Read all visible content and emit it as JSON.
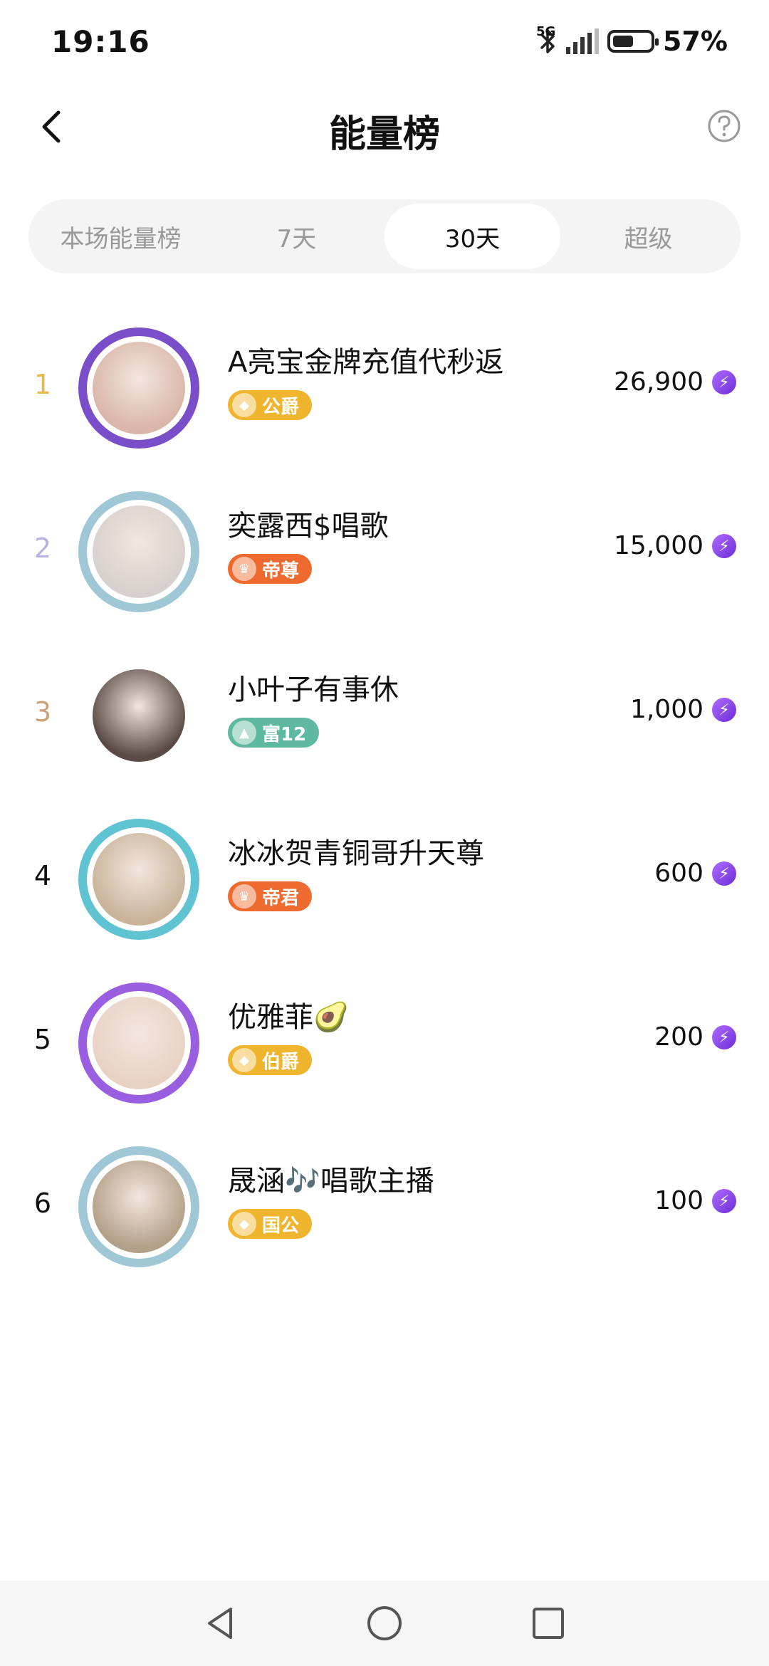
{
  "status": {
    "time": "19:16",
    "network": "5G",
    "battery": "57%",
    "battery_level": 0.57
  },
  "header": {
    "title": "能量榜",
    "back_icon": "chevron-left-icon",
    "help_icon": "question-circle-icon"
  },
  "tabs": [
    {
      "label": "本场能量榜",
      "active": false
    },
    {
      "label": "7天",
      "active": false
    },
    {
      "label": "30天",
      "active": true
    },
    {
      "label": "超级",
      "active": false
    }
  ],
  "ranking": [
    {
      "rank": "1",
      "rank_color": "#e6b84a",
      "name": "A亮宝金牌充值代秒返",
      "badge": "公爵",
      "badge_color": "#f0b52e",
      "frame_color": "#7b4ec9",
      "avatar_color": "#d9b6a8",
      "score": "26,900"
    },
    {
      "rank": "2",
      "rank_color": "#b8b2e0",
      "name": "奕露西$唱歌",
      "badge": "帝尊",
      "badge_color": "#ee6a2e",
      "frame_color": "#9fc7d6",
      "avatar_color": "#d7d0cc",
      "score": "15,000"
    },
    {
      "rank": "3",
      "rank_color": "#c9a27a",
      "name": "小叶子有事休",
      "badge": "富12",
      "badge_color": "#5fb8a0",
      "frame_color": "#ffffff",
      "avatar_color": "#5a4a45",
      "score": "1,000"
    },
    {
      "rank": "4",
      "rank_color": "#111111",
      "name": "冰冰贺青铜哥升天尊",
      "badge": "帝君",
      "badge_color": "#ee6a2e",
      "frame_color": "#5fc3d2",
      "avatar_color": "#c9b49a",
      "score": "600"
    },
    {
      "rank": "5",
      "rank_color": "#111111",
      "name": "优雅菲🥑",
      "badge": "伯爵",
      "badge_color": "#f0b52e",
      "frame_color": "#9a5ee0",
      "avatar_color": "#e8d2c4",
      "score": "200"
    },
    {
      "rank": "6",
      "rank_color": "#111111",
      "name": "晟涵🎶唱歌主播",
      "badge": "国公",
      "badge_color": "#f0b52e",
      "frame_color": "#9fc7d6",
      "avatar_color": "#b3a088",
      "score": "100"
    }
  ],
  "navbar": {
    "back_icon": "triangle-back-icon",
    "home_icon": "circle-home-icon",
    "recents_icon": "square-recents-icon"
  }
}
